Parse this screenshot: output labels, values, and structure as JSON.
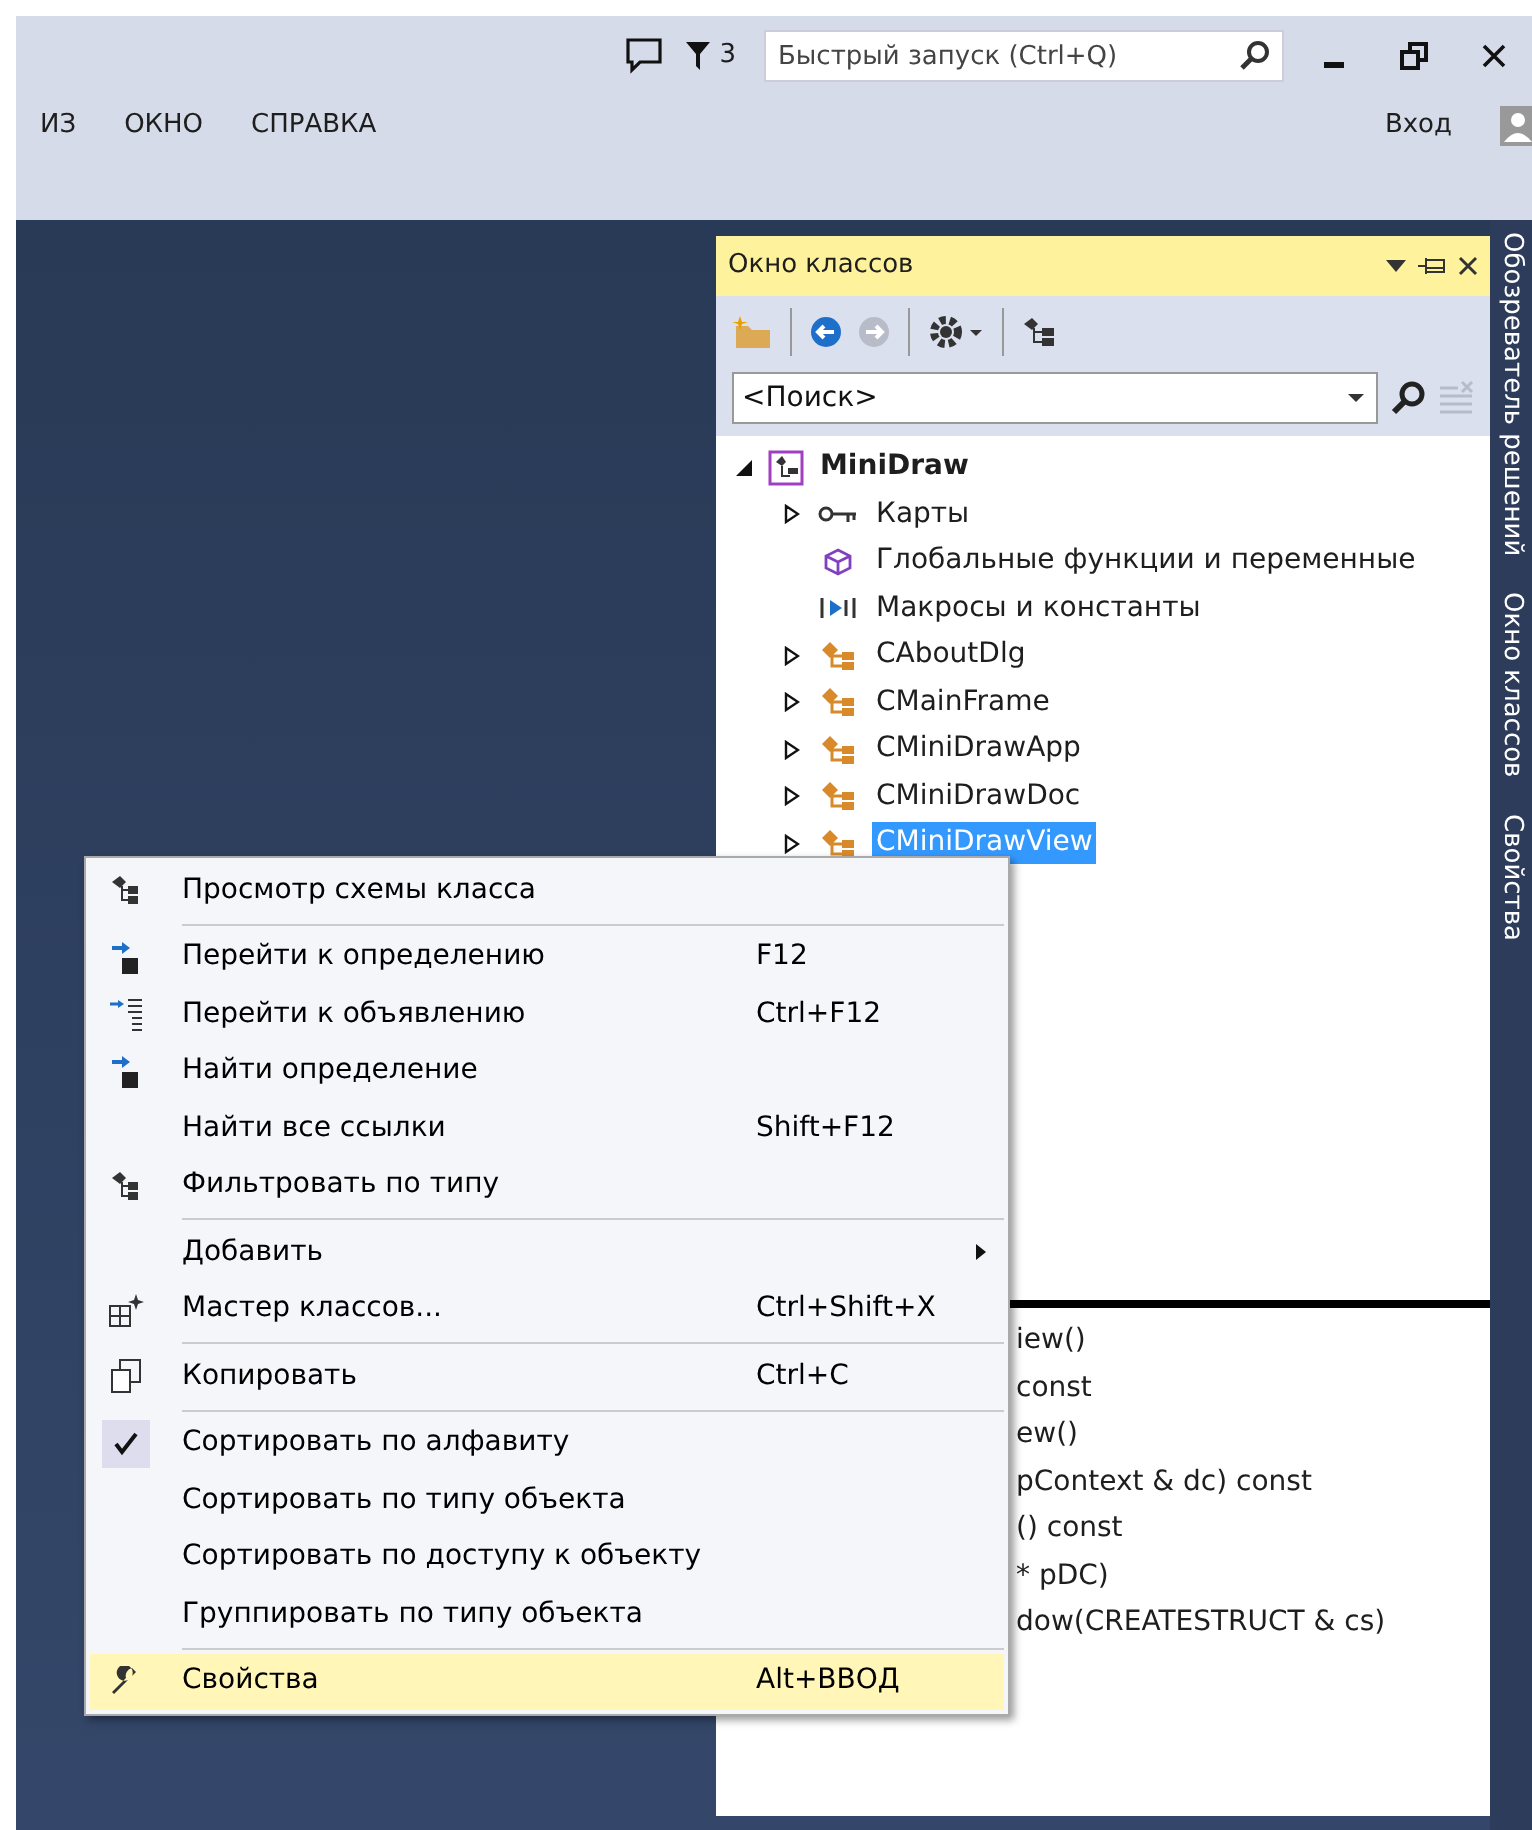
{
  "title_bar": {
    "notification_count": "3",
    "quick_launch": {
      "placeholder": "Быстрый запуск (Ctrl+Q)"
    }
  },
  "menu_bar": [
    "ИЗ",
    "ОКНО",
    "СПРАВКА"
  ],
  "sign_in": "Вход",
  "class_view": {
    "title": "Окно классов",
    "toolbar": [
      {
        "kind": "new-folder",
        "disabled": false
      },
      {
        "kind": "back",
        "disabled": false
      },
      {
        "kind": "forward",
        "disabled": true
      },
      {
        "kind": "settings",
        "disabled": false
      },
      {
        "kind": "class-diagram",
        "disabled": false
      }
    ],
    "search": {
      "value": "<Поиск>"
    },
    "clear_search_disabled": true,
    "tree": {
      "label": "MiniDraw",
      "expanded": true,
      "children": [
        {
          "label": "Карты",
          "kind": "map",
          "expanded": false,
          "selected": false
        },
        {
          "label": "Глобальные функции и переменные",
          "kind": "global",
          "selected": false
        },
        {
          "label": "Макросы и константы",
          "kind": "macro",
          "selected": false
        },
        {
          "label": "CAboutDlg",
          "kind": "class",
          "expanded": false,
          "selected": false
        },
        {
          "label": "CMainFrame",
          "kind": "class",
          "expanded": false,
          "selected": false
        },
        {
          "label": "CMiniDrawApp",
          "kind": "class",
          "expanded": false,
          "selected": false
        },
        {
          "label": "CMiniDrawDoc",
          "kind": "class",
          "expanded": false,
          "selected": false
        },
        {
          "label": "CMiniDrawView",
          "kind": "class",
          "expanded": false,
          "selected": true
        }
      ]
    },
    "members": [
      "iew()",
      "const",
      "ew()",
      "pContext & dc) const",
      "() const",
      "* pDC)",
      "dow(CREATESTRUCT & cs)"
    ]
  },
  "side_tabs": [
    "Обозреватель решений",
    "Окно классов",
    "Свойства"
  ],
  "context_menu": {
    "groups": [
      [
        {
          "label": "Просмотр схемы класса",
          "kind": "class-diagram",
          "checked": false,
          "submenu": false,
          "selected": false
        }
      ],
      [
        {
          "label": "Перейти к определению",
          "shortcut": "F12",
          "kind": "goto",
          "checked": false,
          "submenu": false,
          "selected": false
        },
        {
          "label": "Перейти к объявлению",
          "shortcut": "Ctrl+F12",
          "kind": "goto-list",
          "checked": false,
          "submenu": false,
          "selected": false
        },
        {
          "label": "Найти определение",
          "kind": "goto",
          "checked": false,
          "submenu": false,
          "selected": false
        },
        {
          "label": "Найти все ссылки",
          "shortcut": "Shift+F12",
          "kind": "plain",
          "checked": false,
          "submenu": false,
          "selected": false
        },
        {
          "label": "Фильтровать по типу",
          "kind": "class-diagram",
          "checked": false,
          "submenu": false,
          "selected": false
        }
      ],
      [
        {
          "label": "Добавить",
          "kind": "plain",
          "checked": false,
          "submenu": true,
          "selected": false
        },
        {
          "label": "Мастер классов...",
          "shortcut": "Ctrl+Shift+X",
          "kind": "wizard",
          "checked": false,
          "submenu": false,
          "selected": false
        }
      ],
      [
        {
          "label": "Копировать",
          "shortcut": "Ctrl+C",
          "kind": "copy",
          "checked": false,
          "submenu": false,
          "selected": false
        }
      ],
      [
        {
          "label": "Сортировать по алфавиту",
          "kind": "plain",
          "checked": true,
          "submenu": false,
          "selected": false
        },
        {
          "label": "Сортировать по типу объекта",
          "kind": "plain",
          "checked": false,
          "submenu": false,
          "selected": false
        },
        {
          "label": "Сортировать по доступу к объекту",
          "kind": "plain",
          "checked": false,
          "submenu": false,
          "selected": false
        },
        {
          "label": "Группировать по типу объекта",
          "kind": "plain",
          "checked": false,
          "submenu": false,
          "selected": false
        }
      ],
      [
        {
          "label": "Свойства",
          "shortcut": "Alt+ВВОД",
          "kind": "wrench",
          "checked": false,
          "submenu": false,
          "selected": true
        }
      ]
    ]
  }
}
